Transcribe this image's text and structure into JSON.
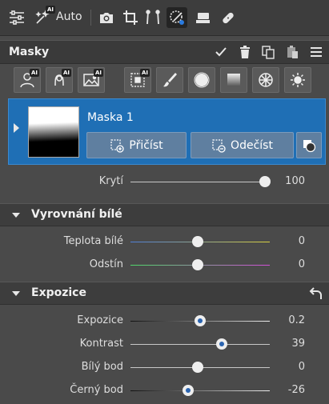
{
  "toolbar": {
    "auto_label": "Auto",
    "ai_badge": "AI",
    "icons": [
      "sliders-icon",
      "magic-wand-icon",
      "camera-icon",
      "crop-icon",
      "perspective-icon",
      "mask-brush-icon",
      "stamp-icon",
      "bandage-icon"
    ]
  },
  "masks": {
    "title": "Masky",
    "header_icons": [
      "checkbox-icon",
      "trash-icon",
      "duplicate-icon",
      "paste-icon",
      "menu-icon"
    ]
  },
  "tools": {
    "ai_badge": "AI",
    "items": [
      "person-ai-icon",
      "portrait-ai-icon",
      "landscape-ai-icon",
      "select-icon",
      "brush-icon",
      "radial-icon",
      "gradient-icon",
      "color-range-icon",
      "luminance-icon"
    ]
  },
  "mask_item": {
    "name": "Maska 1",
    "add_label": "Přičíst",
    "subtract_label": "Odečíst",
    "accent": "#1f6fb5"
  },
  "opacity": {
    "label": "Krytí",
    "value": "100",
    "level": 1.0
  },
  "white_balance": {
    "title": "Vyrovnání bílé",
    "rows": [
      {
        "label": "Teplota bílé",
        "value": "0",
        "level": 0.5
      },
      {
        "label": "Odstín",
        "value": "0",
        "level": 0.5
      }
    ]
  },
  "exposure": {
    "title": "Expozice",
    "rows": [
      {
        "label": "Expozice",
        "value": "0.2",
        "level": 0.52
      },
      {
        "label": "Kontrast",
        "value": "39",
        "level": 0.68
      },
      {
        "label": "Bílý bod",
        "value": "0",
        "level": 0.5
      },
      {
        "label": "Černý bod",
        "value": "-26",
        "level": 0.43
      }
    ]
  }
}
